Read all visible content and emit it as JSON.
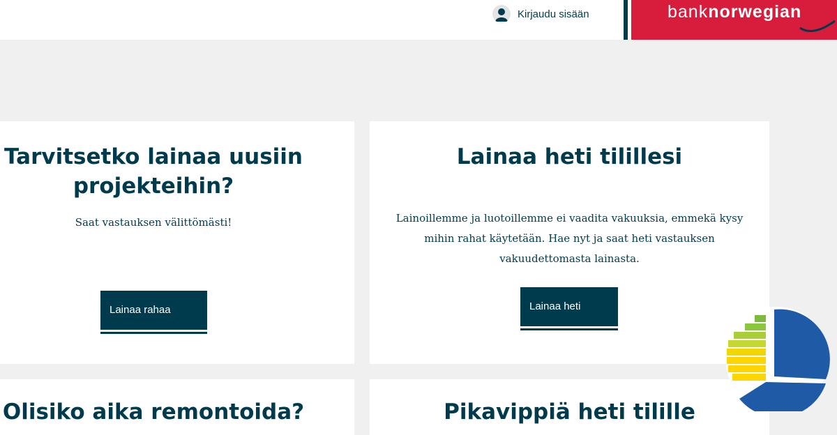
{
  "header": {
    "login_label": "Kirjaudu sisään",
    "brand_light": "bank",
    "brand_bold": "norwegian"
  },
  "cards": [
    {
      "title": "Tarvitsetko lainaa uusiin projekteihin?",
      "text": "Saat vastauksen välittömästi!",
      "button": "Lainaa rahaa"
    },
    {
      "title": "Lainaa heti tilillesi",
      "text": "Lainoillemme ja luotoillemme ei vaadita vakuuksia, emmekä kysy mihin rahat käytetään. Hae nyt ja saat heti vastauksen vakuudettomasta lainasta.",
      "button": "Lainaa heti"
    },
    {
      "title": "Olisiko aika remontoida?"
    },
    {
      "title": "Pikavippiä heti tilille"
    }
  ],
  "colors": {
    "primary": "#003b4d",
    "brand": "#d81d3c",
    "background": "#f0f0f0"
  },
  "icons": [
    "user-icon",
    "swoosh-icon",
    "energy-rating-badge-icon"
  ]
}
